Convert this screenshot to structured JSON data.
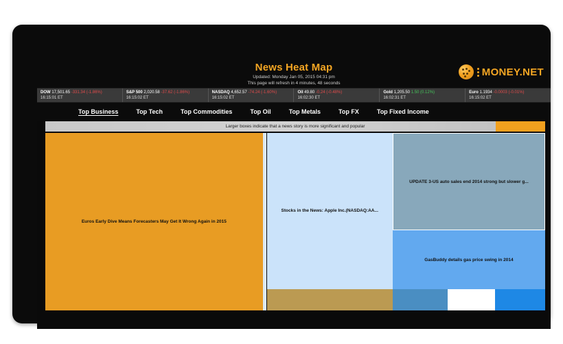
{
  "header": {
    "title": "News Heat Map",
    "updated": "Updated: Monday Jan 05, 2015 04:31 pm",
    "refresh": "This page will refresh in 4 minutes, 48 seconds",
    "logo_text": "MONEY.NET",
    "logo_icon": "money-net-logo-icon"
  },
  "ticker": [
    {
      "symbol": "DOW",
      "price": "17,501.65",
      "change": "-331.34 (-1.86%)",
      "direction": "down",
      "time": "16:15:01 ET"
    },
    {
      "symbol": "S&P 500",
      "price": "2,020.58",
      "change": "-37.62 (-1.86%)",
      "direction": "down",
      "time": "16:15:02 ET"
    },
    {
      "symbol": "NASDAQ",
      "price": "4,652.57",
      "change": "-74.24 (-1.60%)",
      "direction": "down",
      "time": "16:15:02 ET"
    },
    {
      "symbol": "Oil",
      "price": "49.80",
      "change": "-0.24 (-0.48%)",
      "direction": "down",
      "time": "16:02:30 ET"
    },
    {
      "symbol": "Gold",
      "price": "1,205.50",
      "change": "1.50 (0.12%)",
      "direction": "up",
      "time": "16:02:31 ET"
    },
    {
      "symbol": "Euro",
      "price": "1.1934",
      "change": "-0.0003 (-0.01%)",
      "direction": "down",
      "time": "16:15:02 ET"
    }
  ],
  "tabs": [
    {
      "label": "Top Business",
      "active": true
    },
    {
      "label": "Top Tech",
      "active": false
    },
    {
      "label": "Top Commodities",
      "active": false
    },
    {
      "label": "Top Oil",
      "active": false
    },
    {
      "label": "Top Metals",
      "active": false
    },
    {
      "label": "Top FX",
      "active": false
    },
    {
      "label": "Top Fixed Income",
      "active": false
    }
  ],
  "legend": {
    "text": "Larger boxes indicate that a news story is more significant and popular"
  },
  "treemap": {
    "tiles": [
      {
        "headline": "Euros Early Dive Means Forecasters May Get It Wrong Again in 2015",
        "color": "#e89c23"
      },
      {
        "headline": "Stocks in the News: Apple Inc.(NASDAQ:AA...",
        "color": "#cbe3fa"
      },
      {
        "headline": "UPDATE 3-US auto sales end 2014 strong but slower g...",
        "color": "#88a8bb"
      },
      {
        "headline": "GasBuddy details gas price swing in 2014",
        "color": "#62a9ef"
      },
      {
        "headline": "",
        "color": "#bb9a52"
      },
      {
        "headline": "",
        "color": "#4a8ec2"
      },
      {
        "headline": "",
        "color": "#ffffff"
      },
      {
        "headline": "",
        "color": "#1e88e5"
      }
    ]
  }
}
